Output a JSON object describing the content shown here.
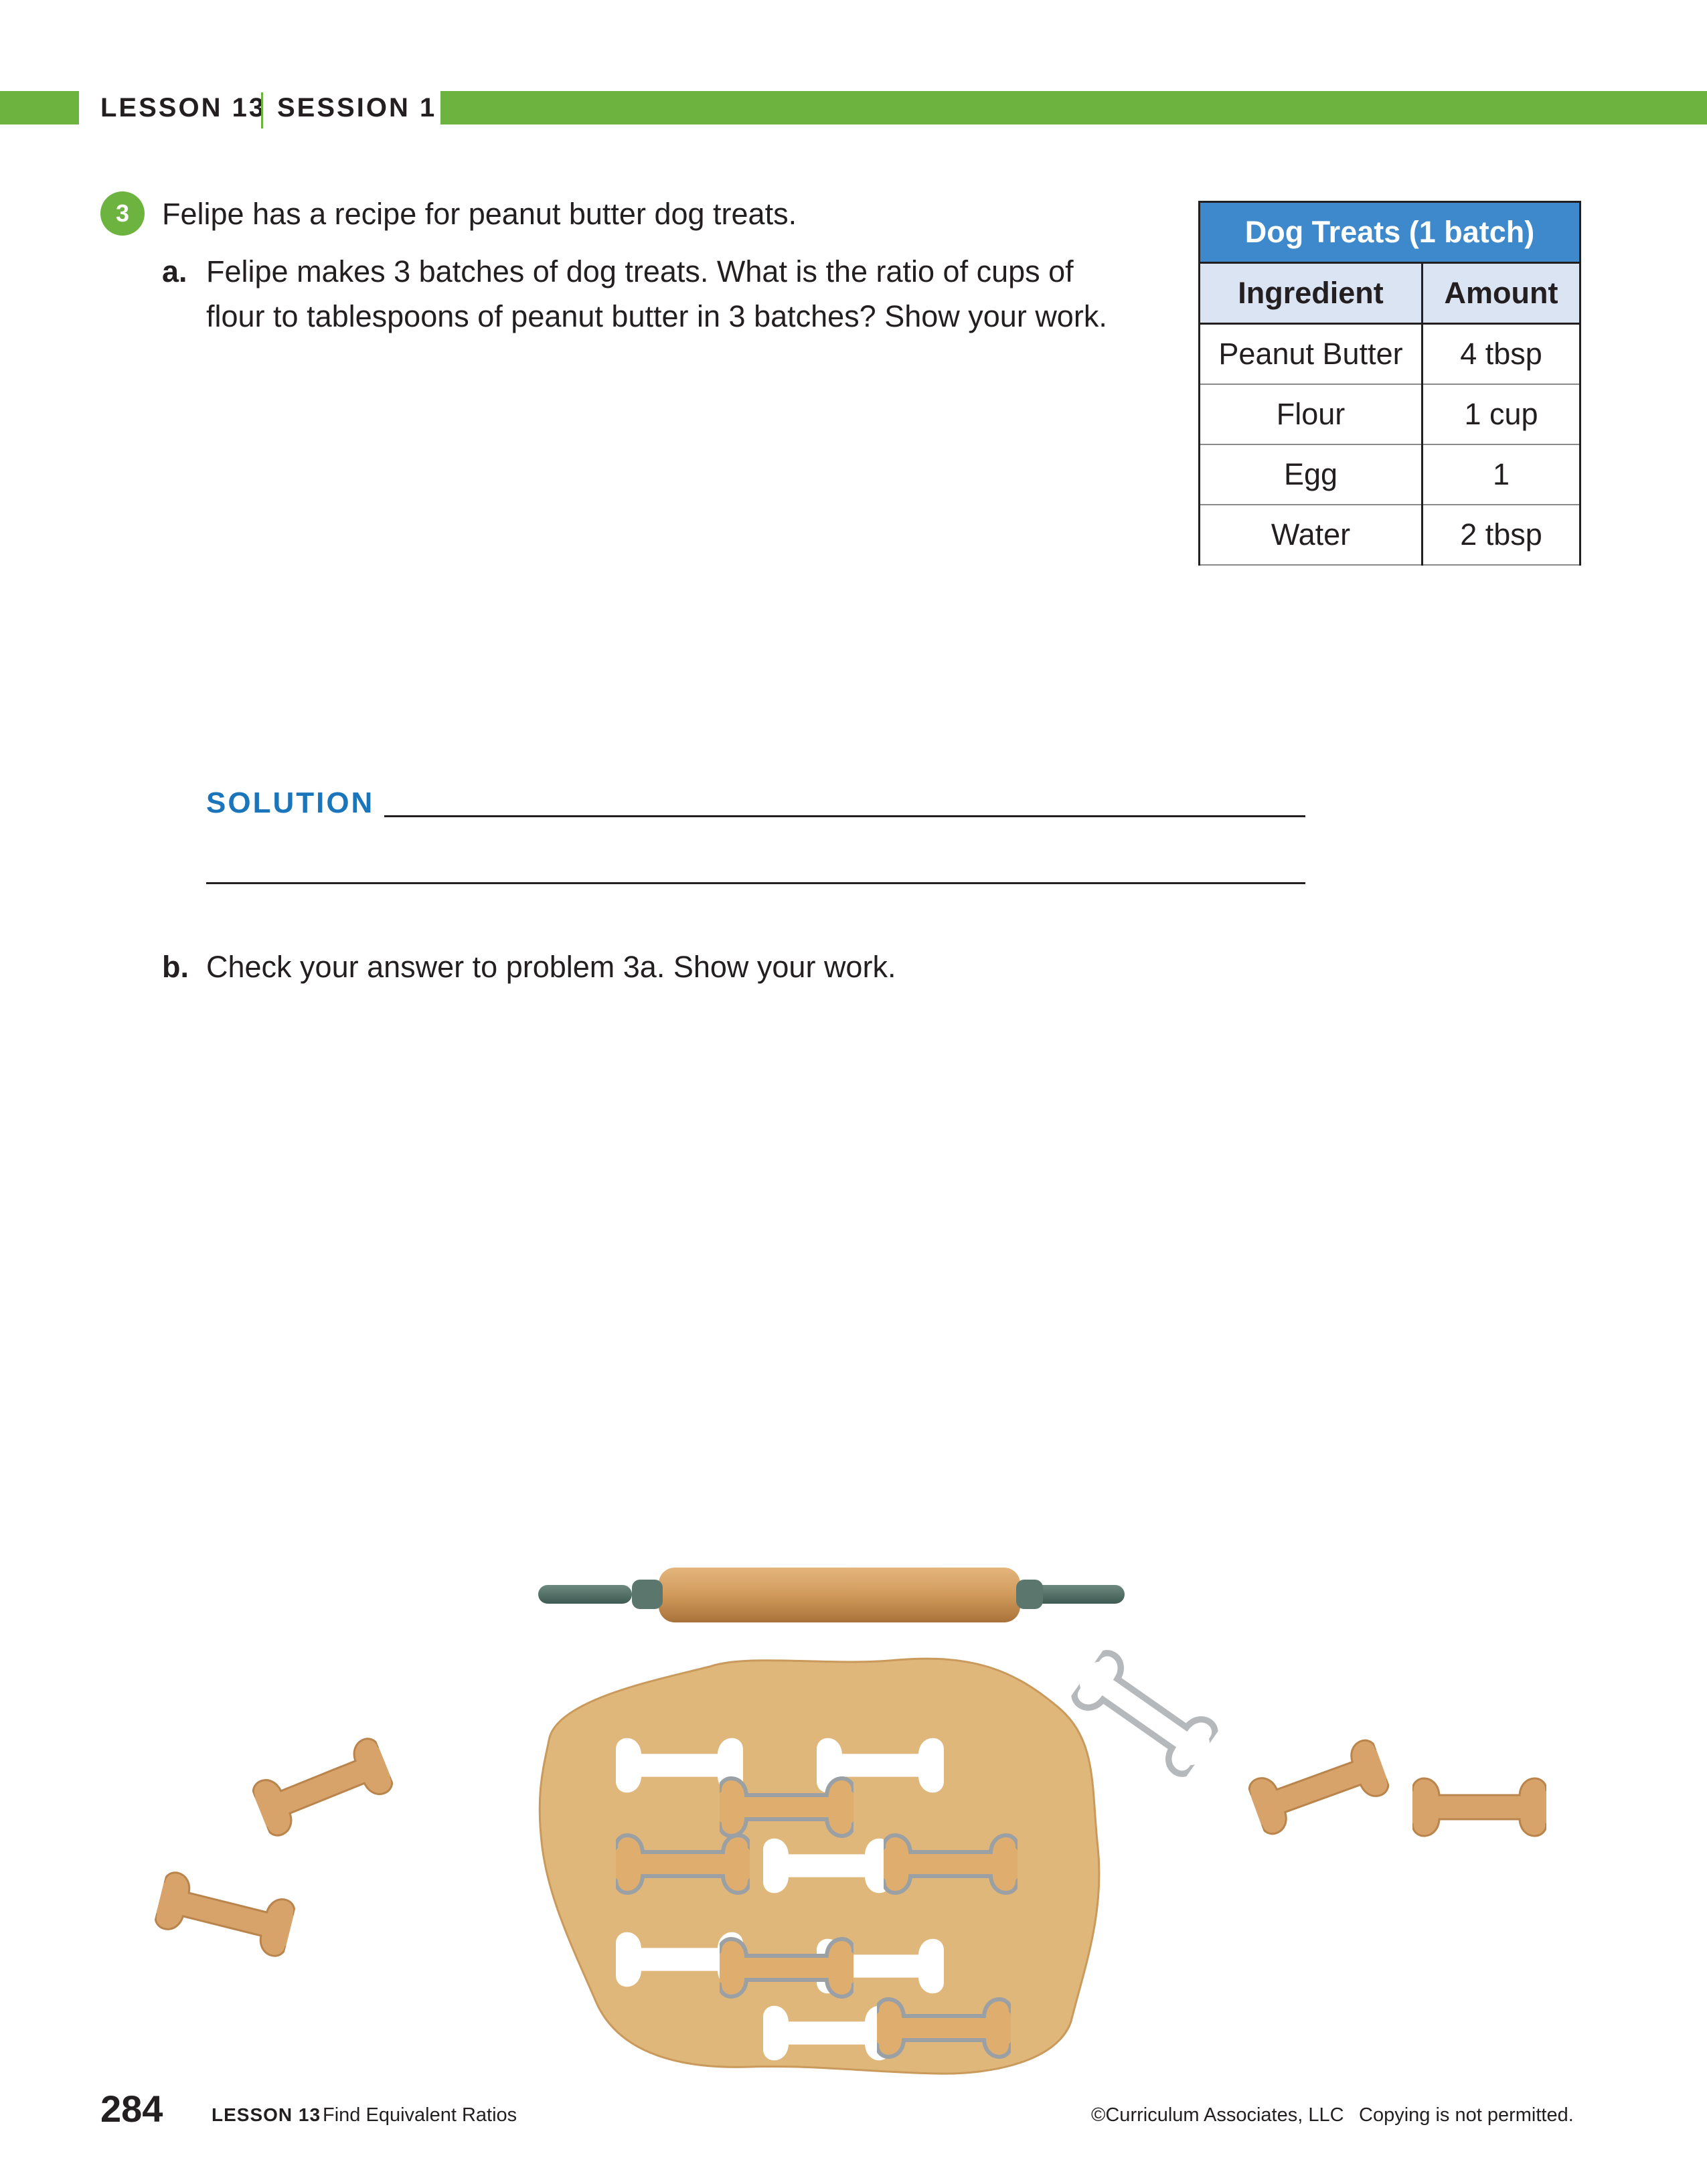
{
  "header": {
    "lesson": "LESSON 13",
    "session": "SESSION 1"
  },
  "problem": {
    "number": "3",
    "intro": "Felipe has a recipe for peanut butter dog treats.",
    "part_a": {
      "label": "a.",
      "line1": "Felipe makes 3 batches of dog treats. What is the ratio of cups of",
      "line2": "flour to tablespoons of peanut butter in 3 batches? Show your work."
    },
    "solution_label": "SOLUTION",
    "part_b": {
      "label": "b.",
      "text": "Check your answer to problem 3a. Show your work."
    }
  },
  "table": {
    "title": "Dog Treats (1 batch)",
    "headers": [
      "Ingredient",
      "Amount"
    ],
    "rows": [
      [
        "Peanut Butter",
        "4 tbsp"
      ],
      [
        "Flour",
        "1 cup"
      ],
      [
        "Egg",
        "1"
      ],
      [
        "Water",
        "2 tbsp"
      ]
    ]
  },
  "footer": {
    "page_number": "284",
    "lesson": "LESSON 13",
    "lesson_title": "Find Equivalent Ratios",
    "copyright": "©Curriculum Associates, LLC",
    "notice": "Copying is not permitted."
  },
  "colors": {
    "accent_green": "#6db33f",
    "table_title_blue": "#3d89cc",
    "table_header_bg": "#dbe4f3",
    "solution_blue": "#1b75bb"
  }
}
